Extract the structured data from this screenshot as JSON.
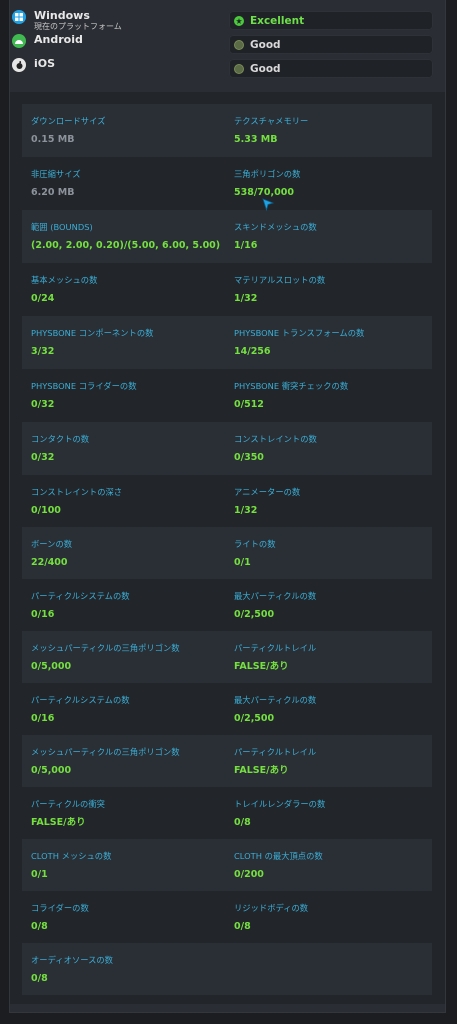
{
  "platforms": [
    {
      "name": "Windows",
      "subtitle": "現在のプラットフォーム",
      "icon": "windows-icon",
      "rating": "Excellent",
      "rating_icon": "excellent-badge-icon"
    },
    {
      "name": "Android",
      "subtitle": "",
      "icon": "android-icon",
      "rating": "Good",
      "rating_icon": "good-badge-icon"
    },
    {
      "name": "iOS",
      "subtitle": "",
      "icon": "apple-icon",
      "rating": "Good",
      "rating_icon": "good-badge-icon"
    }
  ],
  "colors": {
    "label": "#3bb0d8",
    "value": "#75e040",
    "muted": "#8d939b",
    "excellent": "#4cc93c"
  },
  "stats": [
    {
      "left": {
        "label": "ダウンロードサイズ",
        "value": "0.15 MB",
        "muted": true
      },
      "right": {
        "label": "テクスチャメモリー",
        "value": "5.33 MB"
      }
    },
    {
      "left": {
        "label": "非圧縮サイズ",
        "value": "6.20 MB",
        "muted": true
      },
      "right": {
        "label": "三角ポリゴンの数",
        "value": "538/70,000"
      }
    },
    {
      "left": {
        "label": "範囲 (BOUNDS)",
        "value": "(2.00, 2.00, 0.20)/(5.00, 6.00, 5.00)"
      },
      "right": {
        "label": "スキンドメッシュの数",
        "value": "1/16"
      }
    },
    {
      "left": {
        "label": "基本メッシュの数",
        "value": "0/24"
      },
      "right": {
        "label": "マテリアルスロットの数",
        "value": "1/32"
      }
    },
    {
      "left": {
        "label": "PHYSBONE コンポーネントの数",
        "value": "3/32"
      },
      "right": {
        "label": "PHYSBONE トランスフォームの数",
        "value": "14/256"
      }
    },
    {
      "left": {
        "label": "PHYSBONE コライダーの数",
        "value": "0/32"
      },
      "right": {
        "label": "PHYSBONE 衝突チェックの数",
        "value": "0/512"
      }
    },
    {
      "left": {
        "label": "コンタクトの数",
        "value": "0/32"
      },
      "right": {
        "label": "コンストレイントの数",
        "value": "0/350"
      }
    },
    {
      "left": {
        "label": "コンストレイントの深さ",
        "value": "0/100"
      },
      "right": {
        "label": "アニメーターの数",
        "value": "1/32"
      }
    },
    {
      "left": {
        "label": "ボーンの数",
        "value": "22/400"
      },
      "right": {
        "label": "ライトの数",
        "value": "0/1"
      }
    },
    {
      "left": {
        "label": "パーティクルシステムの数",
        "value": "0/16"
      },
      "right": {
        "label": "最大パーティクルの数",
        "value": "0/2,500"
      }
    },
    {
      "left": {
        "label": "メッシュパーティクルの三角ポリゴン数",
        "value": "0/5,000"
      },
      "right": {
        "label": "パーティクルトレイル",
        "value": "FALSE/あり"
      }
    },
    {
      "left": {
        "label": "パーティクルシステムの数",
        "value": "0/16"
      },
      "right": {
        "label": "最大パーティクルの数",
        "value": "0/2,500"
      }
    },
    {
      "left": {
        "label": "メッシュパーティクルの三角ポリゴン数",
        "value": "0/5,000"
      },
      "right": {
        "label": "パーティクルトレイル",
        "value": "FALSE/あり"
      }
    },
    {
      "left": {
        "label": "パーティクルの衝突",
        "value": "FALSE/あり"
      },
      "right": {
        "label": "トレイルレンダラーの数",
        "value": "0/8"
      }
    },
    {
      "left": {
        "label": "CLOTH メッシュの数",
        "value": "0/1"
      },
      "right": {
        "label": "CLOTH の最大頂点の数",
        "value": "0/200"
      }
    },
    {
      "left": {
        "label": "コライダーの数",
        "value": "0/8"
      },
      "right": {
        "label": "リジッドボディの数",
        "value": "0/8"
      }
    },
    {
      "left": {
        "label": "オーディオソースの数",
        "value": "0/8"
      },
      "right": null
    }
  ]
}
